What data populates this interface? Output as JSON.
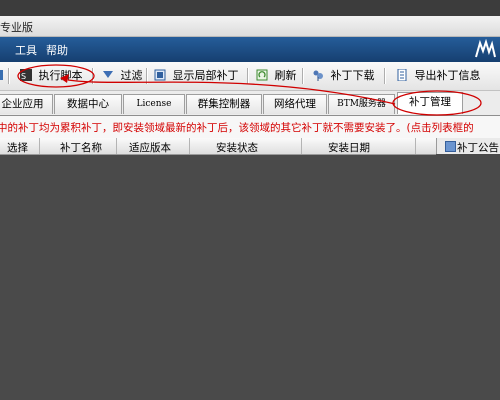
{
  "window": {
    "title": "专业版"
  },
  "menu": {
    "items": [
      "",
      "工具",
      "帮助"
    ]
  },
  "toolbar": {
    "items": [
      {
        "label": "执行脚本",
        "icon": "script-run-icon"
      },
      {
        "label": "过滤",
        "icon": "filter-icon"
      },
      {
        "label": "显示局部补丁",
        "icon": "local-patch-icon"
      },
      {
        "label": "刷新",
        "icon": "refresh-icon"
      },
      {
        "label": "补丁下载",
        "icon": "download-icon"
      },
      {
        "label": "导出补丁信息",
        "icon": "export-icon"
      }
    ]
  },
  "tabs": [
    "企业应用",
    "数据中心",
    "License",
    "群集控制器",
    "网络代理",
    "BTM服务器",
    "补丁管理"
  ],
  "active_tab": "补丁管理",
  "notice": "中的补丁均为累积补丁，即安装领域最新的补丁后，该领域的其它补丁就不需要安装了。(点击列表框的",
  "table": {
    "columns": [
      "选择",
      "补丁名称",
      "适应版本",
      "安装状态",
      "安装日期"
    ]
  },
  "right_panel": {
    "label": "补丁公告"
  },
  "colors": {
    "menubar": "#1f4f86",
    "notice_text": "#d40000",
    "annotation": "#d00000"
  }
}
